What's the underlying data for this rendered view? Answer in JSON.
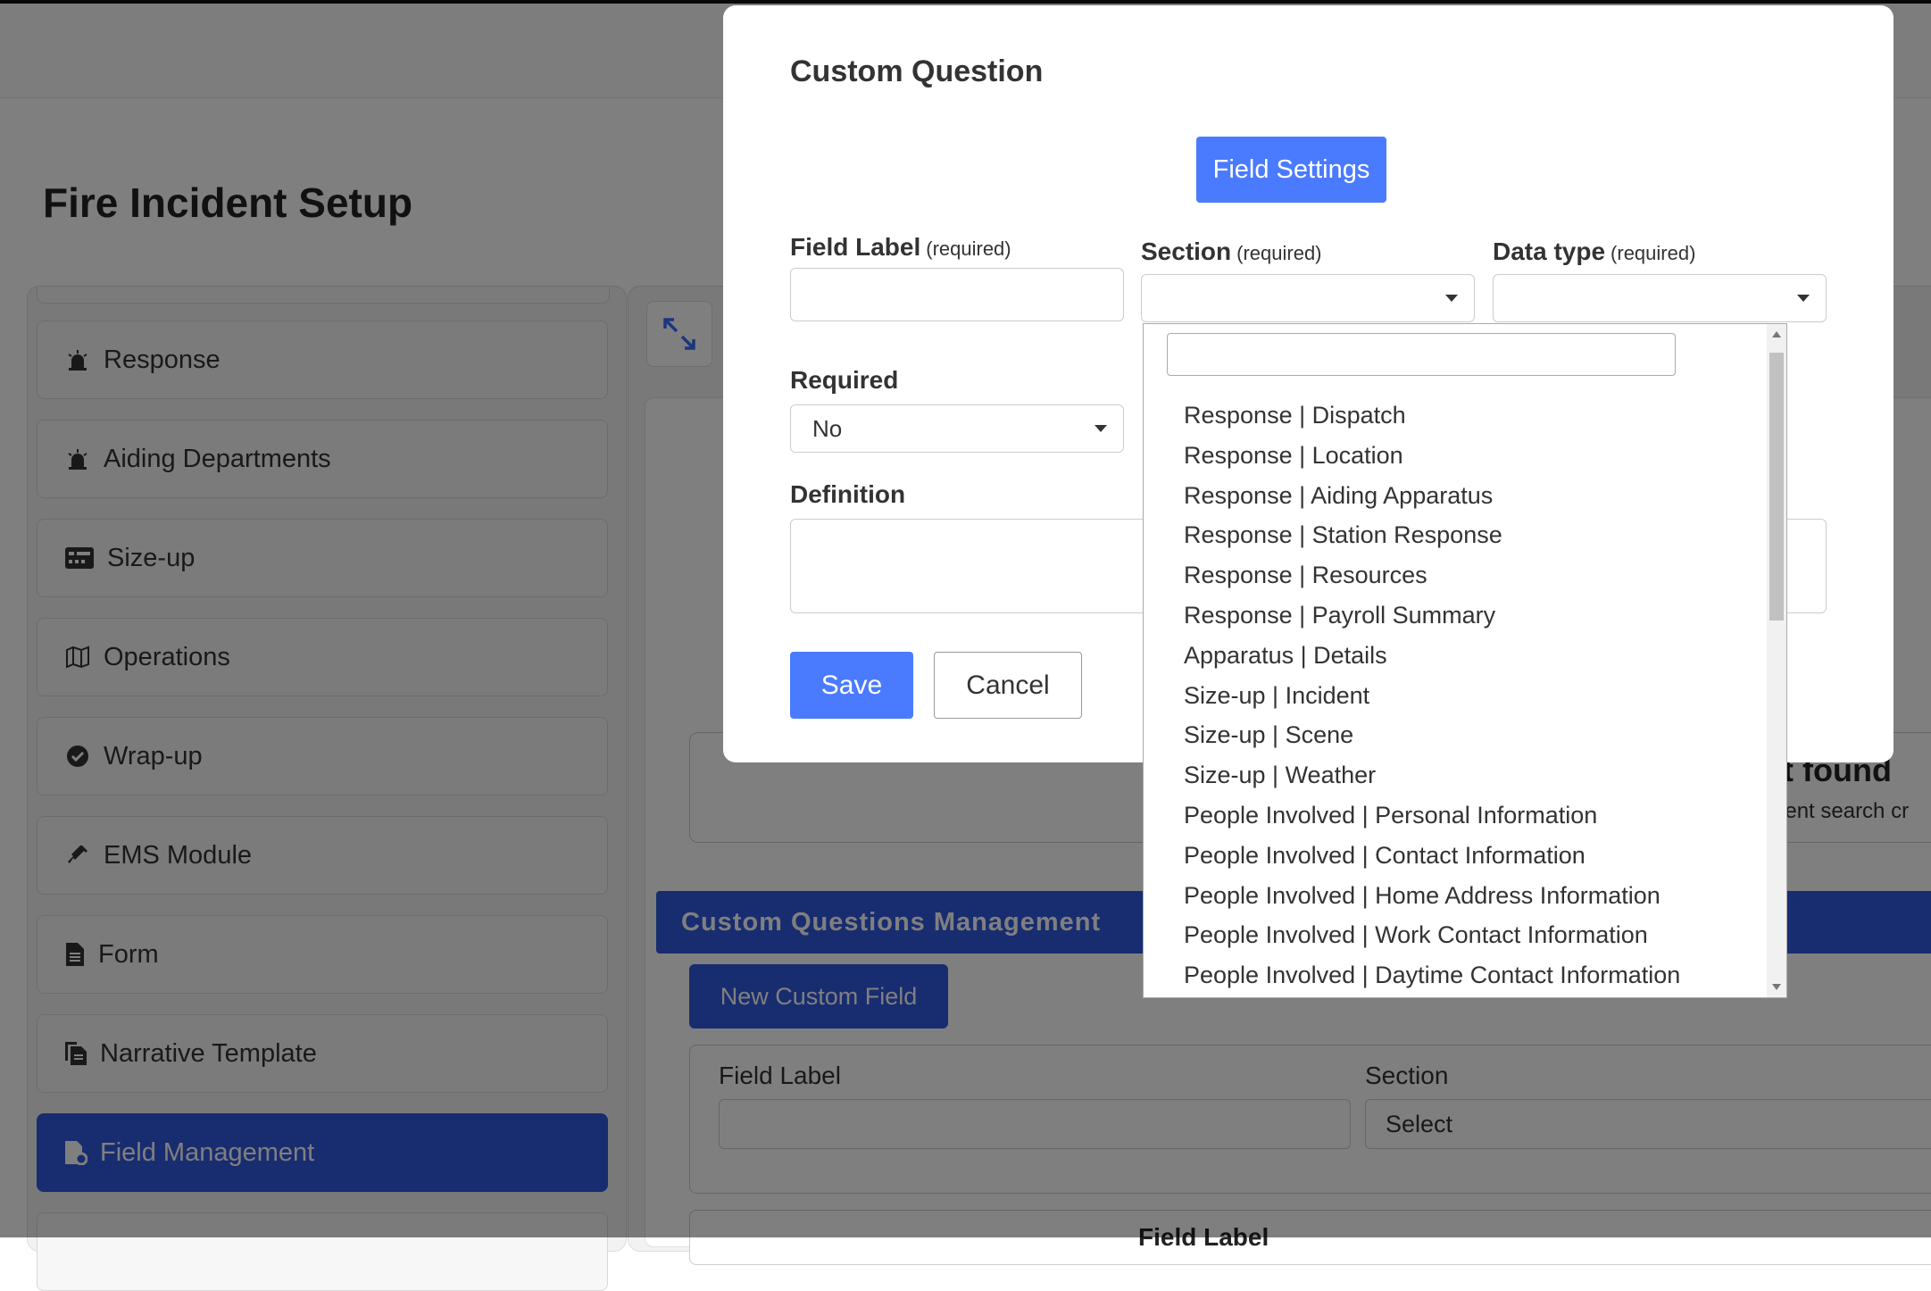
{
  "page": {
    "title": "Fire Incident Setup"
  },
  "sidebar": {
    "items": [
      {
        "label": "Response",
        "icon": "alarm-light-icon"
      },
      {
        "label": "Aiding Departments",
        "icon": "alarm-light-icon"
      },
      {
        "label": "Size-up",
        "icon": "dashboard-card-icon"
      },
      {
        "label": "Operations",
        "icon": "map-icon"
      },
      {
        "label": "Wrap-up",
        "icon": "check-circle-icon"
      },
      {
        "label": "EMS Module",
        "icon": "syringe-icon"
      },
      {
        "label": "Form",
        "icon": "document-icon"
      },
      {
        "label": "Narrative Template",
        "icon": "copy-document-icon"
      },
      {
        "label": "Field Management",
        "icon": "field-settings-icon",
        "active": true
      }
    ]
  },
  "main": {
    "no_result_title": "ult found",
    "no_result_sub": "erent search cr",
    "cqm_title": "Custom Questions Management",
    "new_field_button": "New Custom Field",
    "filter": {
      "field_label": "Field Label",
      "section_label": "Section",
      "section_value": "Select"
    },
    "table_header": "Field Label"
  },
  "modal": {
    "title": "Custom Question",
    "tab_button": "Field Settings",
    "field_label": "Field Label",
    "field_label_req": "(required)",
    "section": "Section",
    "section_req": "(required)",
    "data_type": "Data type",
    "data_type_req": "(required)",
    "required_label": "Required",
    "required_value": "No",
    "definition_label": "Definition",
    "save": "Save",
    "cancel": "Cancel"
  },
  "section_dropdown": {
    "options": [
      "Response | Dispatch",
      "Response | Location",
      "Response | Aiding Apparatus",
      "Response | Station Response",
      "Response | Resources",
      "Response | Payroll Summary",
      "Apparatus | Details",
      "Size-up | Incident",
      "Size-up | Scene",
      "Size-up | Weather",
      "People Involved | Personal Information",
      "People Involved | Contact Information",
      "People Involved | Home Address Information",
      "People Involved | Work Contact Information",
      "People Involved | Daytime Contact Information"
    ]
  },
  "colors": {
    "primary": "#4a7bff",
    "sidebar_active": "#3059e0"
  }
}
